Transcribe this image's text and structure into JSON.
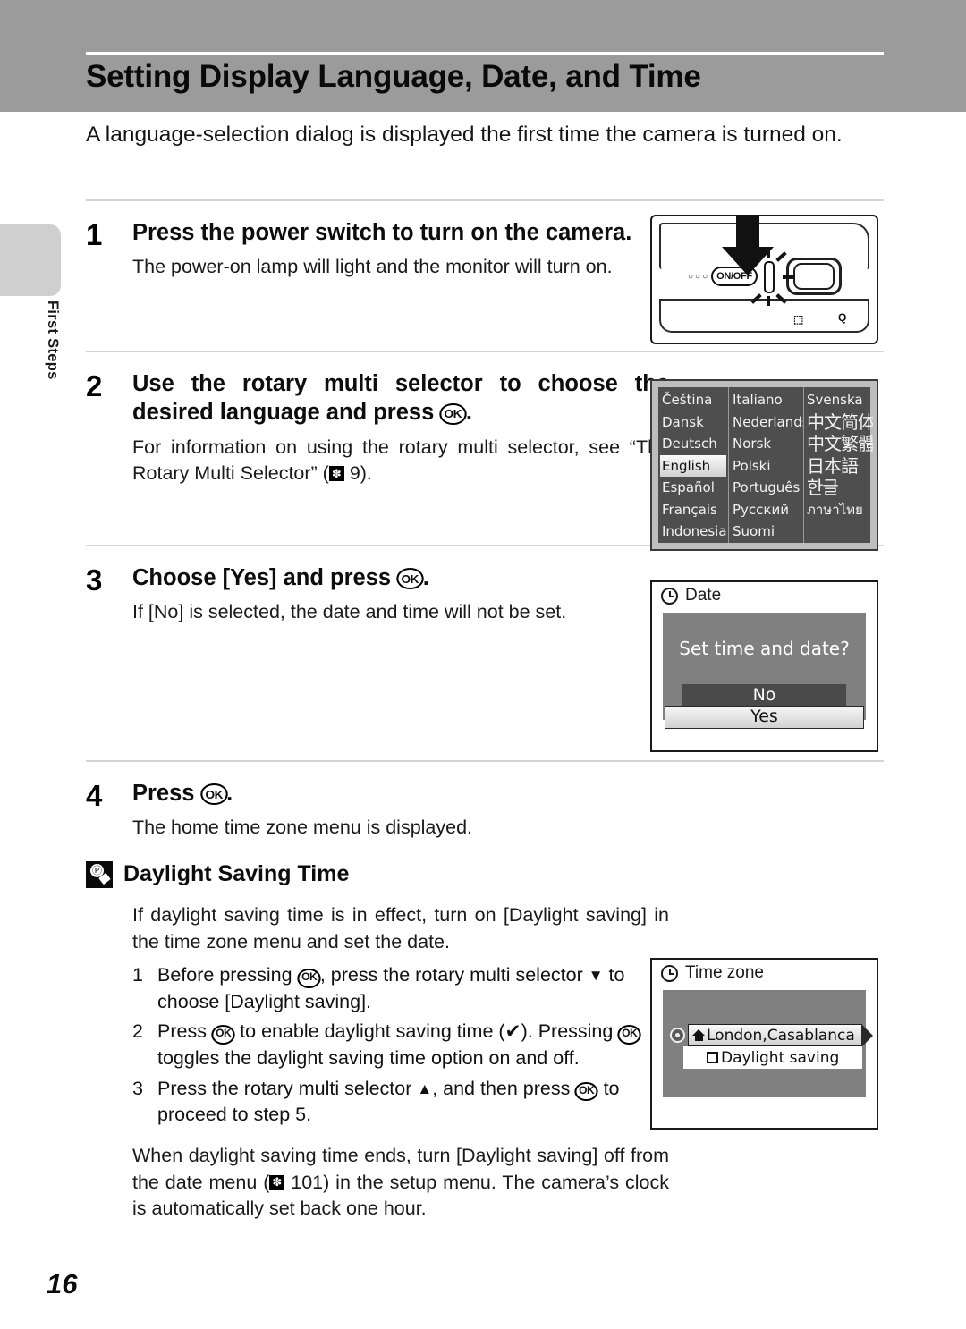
{
  "header": {
    "title": "Setting Display Language, Date, and Time"
  },
  "sidebar": {
    "chapter_label": "First Steps"
  },
  "intro": "A language-selection dialog is displayed the first time the camera is turned on.",
  "steps": [
    {
      "number": "1",
      "title_a": "Press the power switch to turn on the",
      "title_b": "camera.",
      "desc": "The power-on lamp will light and the monitor will turn on."
    },
    {
      "number": "2",
      "title_a": "Use the rotary multi selector to choose",
      "title_b": "the desired language and press ",
      "title_c": ".",
      "desc_a": "For information on using the rotary multi selector, see “The Rotary Multi Selector” (",
      "desc_ref": " 9).",
      "ok_label": "OK"
    },
    {
      "number": "3",
      "title_a": "Choose [Yes] and press ",
      "title_c": ".",
      "desc": "If [No] is selected, the date and time will not be set."
    },
    {
      "number": "4",
      "title_a": "Press ",
      "title_c": ".",
      "desc": "The home time zone menu is displayed."
    }
  ],
  "figures": {
    "camera": {
      "onoff_label": "ON/OFF",
      "dots": "○○○",
      "wide_mark": "⬚",
      "zoom_mark": "Q"
    },
    "language_menu": {
      "col1": [
        "Čeština",
        "Dansk",
        "Deutsch",
        "English",
        "Español",
        "Français",
        "Indonesia"
      ],
      "col2": [
        "Italiano",
        "Nederlands",
        "Norsk",
        "Polski",
        "Português",
        "Русский",
        "Suomi"
      ],
      "col3": [
        "Svenska",
        "中文简体",
        "中文繁體",
        "日本語",
        "한글",
        "ภาษาไทย",
        ""
      ],
      "selected": "English"
    },
    "date_dialog": {
      "title": "Date",
      "question": "Set time and date?",
      "option_no": "No",
      "option_yes": "Yes",
      "selected": "Yes"
    },
    "timezone": {
      "title": "Time zone",
      "city": "London,Casablanca",
      "daylight_label": "Daylight saving",
      "daylight_checked": false
    }
  },
  "tip": {
    "title": "Daylight Saving Time",
    "intro": "If daylight saving time is in effect, turn on [Daylight saving] in the time zone menu and set the date.",
    "items": [
      {
        "number": "1",
        "text_a": "Before pressing ",
        "text_b": ", press the rotary multi selector ",
        "text_c": " to choose [Daylight saving]."
      },
      {
        "number": "2",
        "text_a": "Press ",
        "text_b": " to enable daylight saving time (✔).",
        "text_c": "Pressing ",
        "text_d": " toggles the daylight saving time option on and off."
      },
      {
        "number": "3",
        "text_a": "Press the rotary multi selector ",
        "text_b": ", and then press ",
        "text_c": " to proceed to step 5."
      }
    ],
    "outro_a": "When daylight saving time ends, turn [Daylight saving] off from the date menu (",
    "outro_b": " 101) in the setup menu. The camera’s clock is automatically set back one hour."
  },
  "page_number": "16"
}
